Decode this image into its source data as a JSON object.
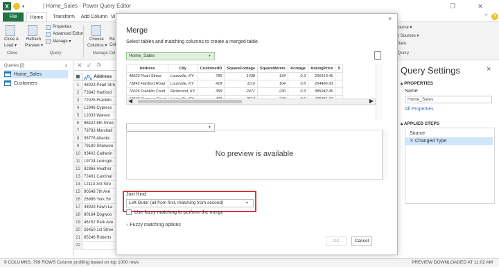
{
  "window": {
    "title": "| Home_Sales - Power Query Editor",
    "app_icon": "X"
  },
  "ribbon_tabs": [
    "File",
    "Home",
    "Transform",
    "Add Column",
    "Vi"
  ],
  "ribbon": {
    "close_load": "Close &",
    "close_load2": "Load ▾",
    "refresh": "Refresh",
    "refresh2": "Preview ▾",
    "properties": "Properties",
    "advanced_editor": "Advanced Editor",
    "manage": "Manage ▾",
    "choose_columns": "Choose",
    "choose_columns2": "Columns ▾",
    "remove_columns": "Re",
    "remove_columns2": "Col",
    "group_close": "Close",
    "group_query": "Query",
    "group_manage_cols": "Manage Col",
    "new_source": "New Source ▾",
    "recent_sources": "Recent Sources ▾",
    "enter_data": "Enter Data",
    "group_new_query": "New Query"
  },
  "queries": {
    "header": "Queries [2]",
    "items": [
      "Home_Sales",
      "Customers"
    ]
  },
  "grid": {
    "header_col": "Address",
    "rows": [
      {
        "n": "1",
        "v": "48023 Pearl Stre"
      },
      {
        "n": "2",
        "v": "73842 Hartford"
      },
      {
        "n": "3",
        "v": "72026 Franklin"
      },
      {
        "n": "4",
        "v": "12946 Cypress"
      },
      {
        "n": "5",
        "v": "12033 Warren"
      },
      {
        "n": "6",
        "v": "96422 6th Stree"
      },
      {
        "n": "7",
        "v": "78793 Marshall"
      },
      {
        "n": "8",
        "v": "36776 Atlantic"
      },
      {
        "n": "9",
        "v": "79180 Sherwoo"
      },
      {
        "n": "10",
        "v": "93402 Catherin"
      },
      {
        "n": "11",
        "v": "19724 Lexingto"
      },
      {
        "n": "12",
        "v": "82866 Heather"
      },
      {
        "n": "13",
        "v": "72481 Cardinal"
      },
      {
        "n": "14",
        "v": "12113 3rd Stre"
      },
      {
        "n": "15",
        "v": "90548 7th Ave"
      },
      {
        "n": "16",
        "v": "26986 York Str"
      },
      {
        "n": "17",
        "v": "48029 Fawn La"
      },
      {
        "n": "18",
        "v": "80164 Dogwoo"
      },
      {
        "n": "19",
        "v": "46152 Park Ave"
      },
      {
        "n": "20",
        "v": "26450 1st Stree"
      },
      {
        "n": "21",
        "v": "85246 Roberts"
      },
      {
        "n": "22",
        "v": ""
      }
    ]
  },
  "dialog": {
    "title": "Merge",
    "subtitle": "Select tables and matching columns to create a merged table.",
    "first_table": "Home_Sales",
    "columns": [
      "Address",
      "City",
      "CustomerID",
      "SquareFootage",
      "SquareMeters",
      "Acreage",
      "AskingPrice",
      "S"
    ],
    "rows": [
      [
        "48023 Pearl Street",
        "Louisville, KY",
        "785",
        "1438",
        "134",
        "0.3",
        "206519.46"
      ],
      [
        "73842 Hartford Road",
        "Louisville, KY",
        "418",
        "1116",
        "104",
        "0.8",
        "204486.93"
      ],
      [
        "72026 Franklin Court",
        "Richmond, KY",
        "358",
        "2471",
        "230",
        "0.3",
        "385942.45"
      ],
      [
        "12946 Cypress Court",
        "Louisville, KY",
        "409",
        "2614",
        "243",
        "0.6",
        "335311.31"
      ],
      [
        "",
        "",
        "",
        "",
        "",
        "",
        ""
      ]
    ],
    "second_table": "",
    "no_preview": "No preview is available",
    "join_kind_label": "Join Kind",
    "join_kind_value": "Left Outer (all from first, matching from second)",
    "fuzzy_checkbox": "Use fuzzy matching to perform the merge",
    "fuzzy_options": "Fuzzy matching options",
    "ok": "OK",
    "cancel": "Cancel",
    "close": "×"
  },
  "settings": {
    "title": "Query Settings",
    "close": "×",
    "properties_header": "▴ PROPERTIES",
    "name_label": "Name",
    "name_value": "Home_Sales",
    "all_properties": "All Properties",
    "applied_header": "▴ APPLIED STEPS",
    "steps": [
      "Source",
      "Changed Type"
    ]
  },
  "status": {
    "left": "9 COLUMNS, 799 ROWS",
    "profiling": "Column profiling based on top 1000 rows",
    "right": "PREVIEW DOWNLOADED AT 11:02 AM"
  },
  "colors": {
    "excel_green": "#217346",
    "highlight_red": "#d9363e",
    "selection_blue": "#cfe6fb",
    "step_green": "#2e8b57"
  }
}
